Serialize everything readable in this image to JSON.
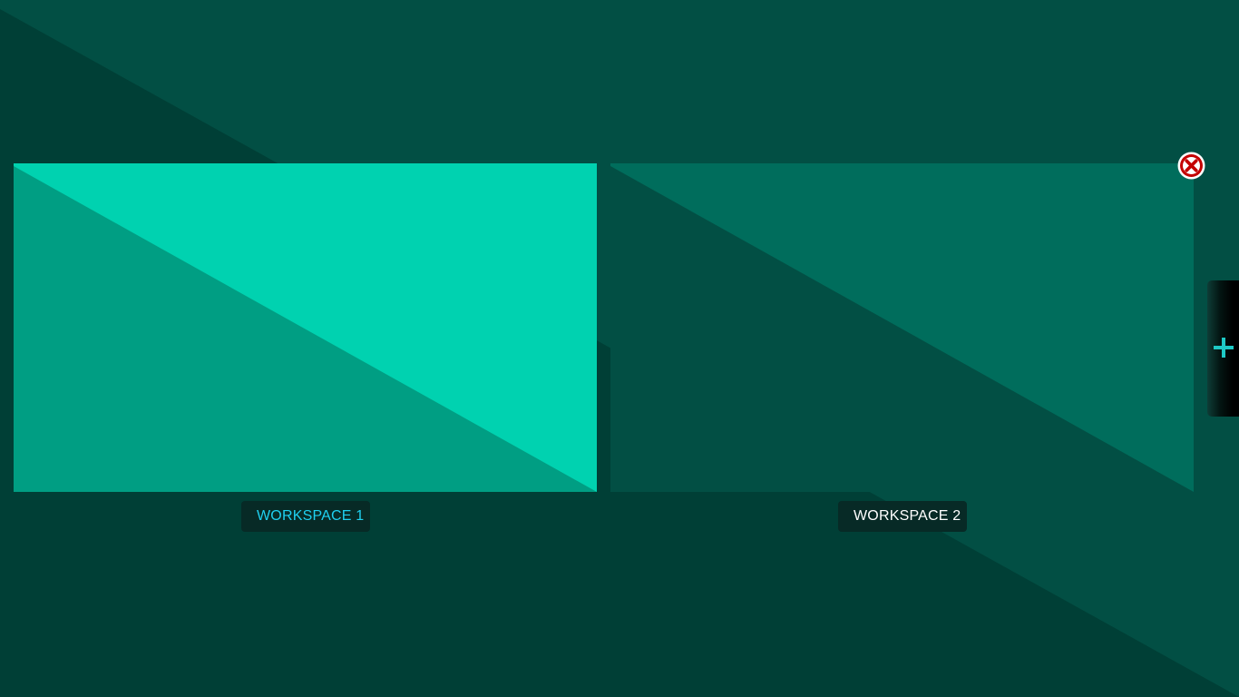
{
  "workspaces": [
    {
      "label": "WORKSPACE 1",
      "active": true,
      "label_color": "#1fd0f0"
    },
    {
      "label": "WORKSPACE 2",
      "active": false,
      "label_color": "#ffffff"
    }
  ],
  "controls": {
    "close_icon": "close-x-circle-icon",
    "add_icon": "plus-icon"
  },
  "colors": {
    "desktop_light": "#024f44",
    "desktop_dark": "#003f36",
    "active_light": "#00d2b0",
    "active_dark": "#009e83",
    "inactive_light": "#006d5c",
    "inactive_dark": "#024f44",
    "label_bg": "#072a26",
    "close_red": "#c40000",
    "accent_cyan": "#1ec9c5"
  }
}
